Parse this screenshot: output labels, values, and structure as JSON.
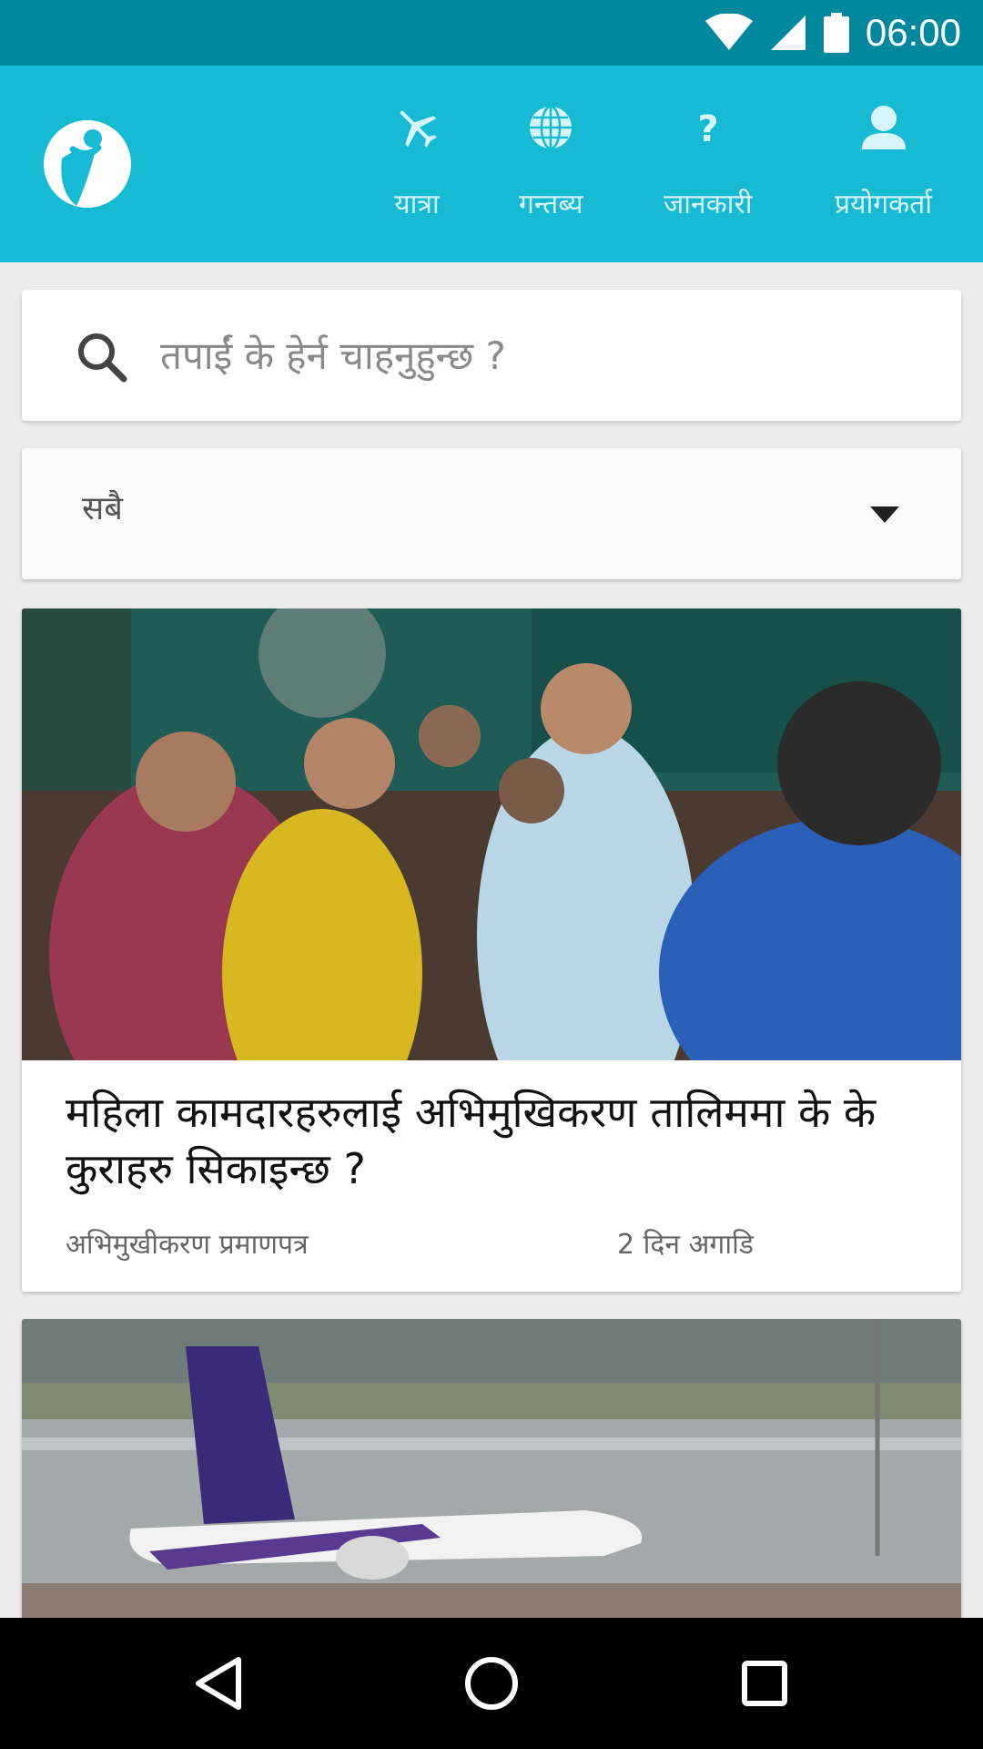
{
  "status_bar": {
    "time": "06:00"
  },
  "header": {
    "logo_icon": "person-leaf-logo-icon",
    "nav": [
      {
        "label": "यात्रा",
        "icon": "airplane-icon"
      },
      {
        "label": "गन्तब्य",
        "icon": "globe-icon"
      },
      {
        "label": "जानकारी",
        "icon": "question-icon"
      },
      {
        "label": "प्रयोगकर्ता",
        "icon": "user-icon"
      }
    ]
  },
  "search": {
    "placeholder": "तपाईं के हेर्न चाहनुहुन्छ ?",
    "value": ""
  },
  "filter": {
    "selected": "सबै"
  },
  "articles": [
    {
      "title": "महिला कामदारहरुलाई अभिमुखिकरण तालिममा के के कुराहरु सिकाइन्छ ?",
      "category": "अभिमुखीकरण प्रमाणपत्र",
      "time_ago": "2 दिन अगाडि"
    }
  ],
  "colors": {
    "status_bar": "#00889e",
    "app_bar": "#16bad3",
    "background": "#ececec"
  }
}
